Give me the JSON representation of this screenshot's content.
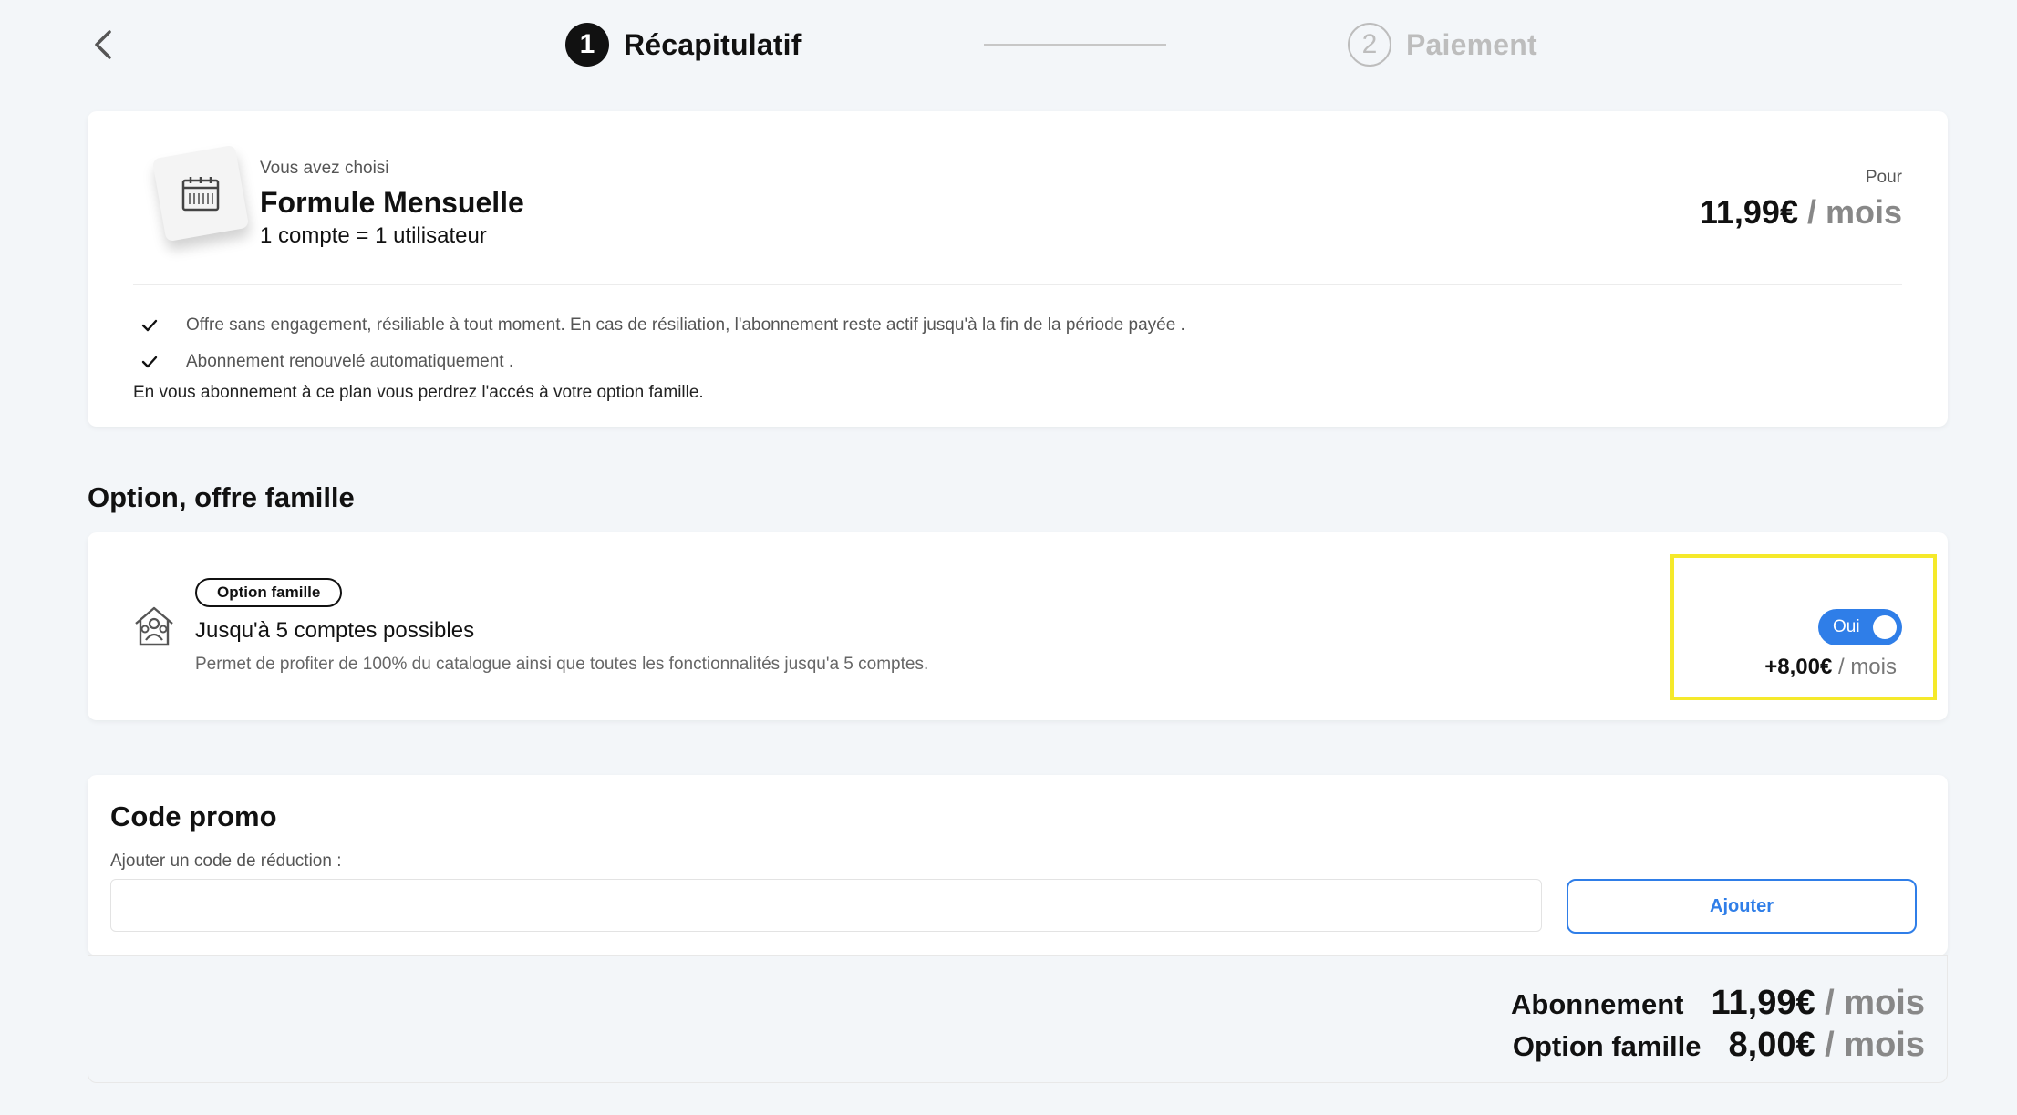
{
  "stepper": {
    "step1": {
      "number": "1",
      "label": "Récapitulatif"
    },
    "step2": {
      "number": "2",
      "label": "Paiement"
    }
  },
  "plan": {
    "chosen_label": "Vous avez choisi",
    "name": "Formule Mensuelle",
    "description": "1 compte = 1 utilisateur",
    "price_for": "Pour",
    "price": "11,99€",
    "price_unit": " / mois",
    "features": [
      "Offre sans engagement, résiliable à tout moment. En cas de résiliation, l'abonnement reste actif jusqu'à la fin de la période payée .",
      "Abonnement renouvelé automatiquement ."
    ],
    "warning": "En vous abonnement à ce plan vous perdrez l'accés à votre option famille."
  },
  "option": {
    "section_title": "Option, offre famille",
    "badge": "Option famille",
    "name": "Jusqu'à 5 comptes possibles",
    "description": "Permet de profiter de 100% du catalogue ainsi que toutes les fonctionnalités jusqu'a 5 comptes.",
    "toggle_label": "Oui",
    "price": "+8,00€",
    "price_unit": " / mois"
  },
  "promo": {
    "title": "Code promo",
    "label": "Ajouter un code de réduction :",
    "input_value": "",
    "button_label": "Ajouter"
  },
  "summary": {
    "rows": [
      {
        "label": "Abonnement",
        "value": "11,99€",
        "unit": " / mois"
      },
      {
        "label": "Option famille",
        "value": "8,00€",
        "unit": " / mois"
      }
    ]
  },
  "colors": {
    "accent": "#2f7ee8",
    "highlight": "#f5e92a",
    "background": "#f3f6f9"
  },
  "icons": {
    "back": "chevron-left-icon",
    "plan": "calendar-icon",
    "feature": "check-icon",
    "option": "family-house-icon"
  }
}
